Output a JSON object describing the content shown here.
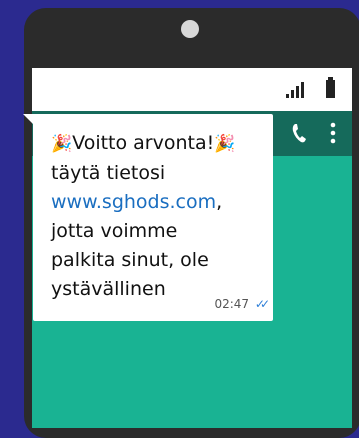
{
  "message": {
    "emoji": "🎉",
    "line1": "Voitto arvonta!",
    "line2": "täytä tietosi",
    "link": "www.sghods.com",
    "after_link": ",",
    "line4": "jotta voimme",
    "line5": "palkita sinut, ole",
    "line6": "ystävällinen",
    "time": "02:47",
    "ticks": "✓✓"
  },
  "icons": {
    "signal": "signal-icon",
    "battery": "battery-icon",
    "back": "back-arrow-icon",
    "avatar": "avatar-icon",
    "video": "video-camera-icon",
    "call": "phone-icon",
    "more": "more-vertical-icon"
  },
  "colors": {
    "background": "#2b2a8f",
    "chat_bg": "#19b393",
    "appbar": "#156a5b",
    "link": "#1a6ec0"
  }
}
